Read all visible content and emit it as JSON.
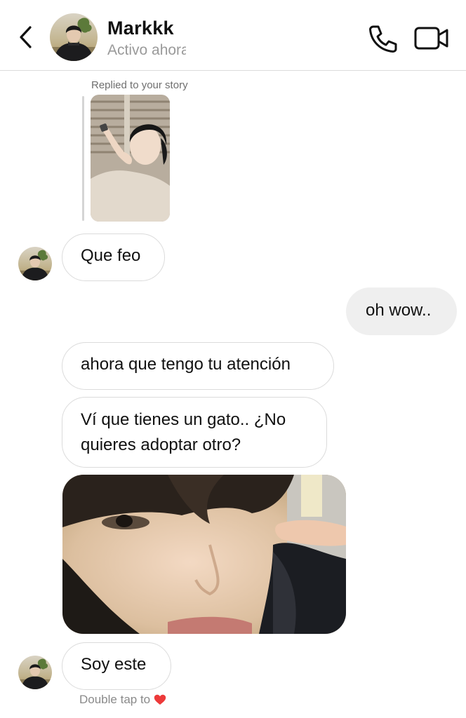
{
  "header": {
    "contact_name": "Markkk",
    "status": "Activo ahora",
    "back_icon": "chevron-left-icon",
    "call_icon": "phone-icon",
    "video_icon": "video-camera-icon"
  },
  "story_reply": {
    "label": "Replied to your story"
  },
  "messages": [
    {
      "from": "them",
      "text": "Que feo"
    },
    {
      "from": "me",
      "text": "oh wow.."
    },
    {
      "from": "them",
      "text": "ahora que tengo tu atención"
    },
    {
      "from": "them",
      "text": "Ví que tienes un gato.. ¿No quieres adoptar otro?"
    },
    {
      "from": "them",
      "type": "photo"
    },
    {
      "from": "them",
      "text": "Soy este"
    }
  ],
  "footer_hint": {
    "text": "Double tap to",
    "icon": "heart-icon",
    "icon_color": "#ed3a3a"
  }
}
